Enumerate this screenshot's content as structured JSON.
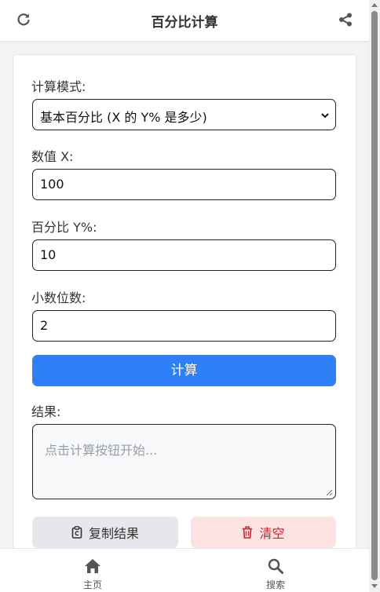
{
  "header": {
    "title": "百分比计算",
    "left_icon": "refresh-icon",
    "right_icon": "share-icon"
  },
  "form": {
    "mode_label": "计算模式:",
    "mode_value": "基本百分比 (X 的 Y% 是多少)",
    "x_label": "数值 X:",
    "x_value": "100",
    "y_label": "百分比 Y%:",
    "y_value": "10",
    "decimals_label": "小数位数:",
    "decimals_value": "2",
    "calculate_label": "计算"
  },
  "result": {
    "label": "结果:",
    "placeholder": "点击计算按钮开始..."
  },
  "actions": {
    "copy_label": "复制结果",
    "clear_label": "清空"
  },
  "nav": {
    "home_label": "主页",
    "search_label": "搜索"
  },
  "colors": {
    "primary": "#2f80f6",
    "danger": "#c8232c",
    "danger_bg": "#fde2e2"
  }
}
